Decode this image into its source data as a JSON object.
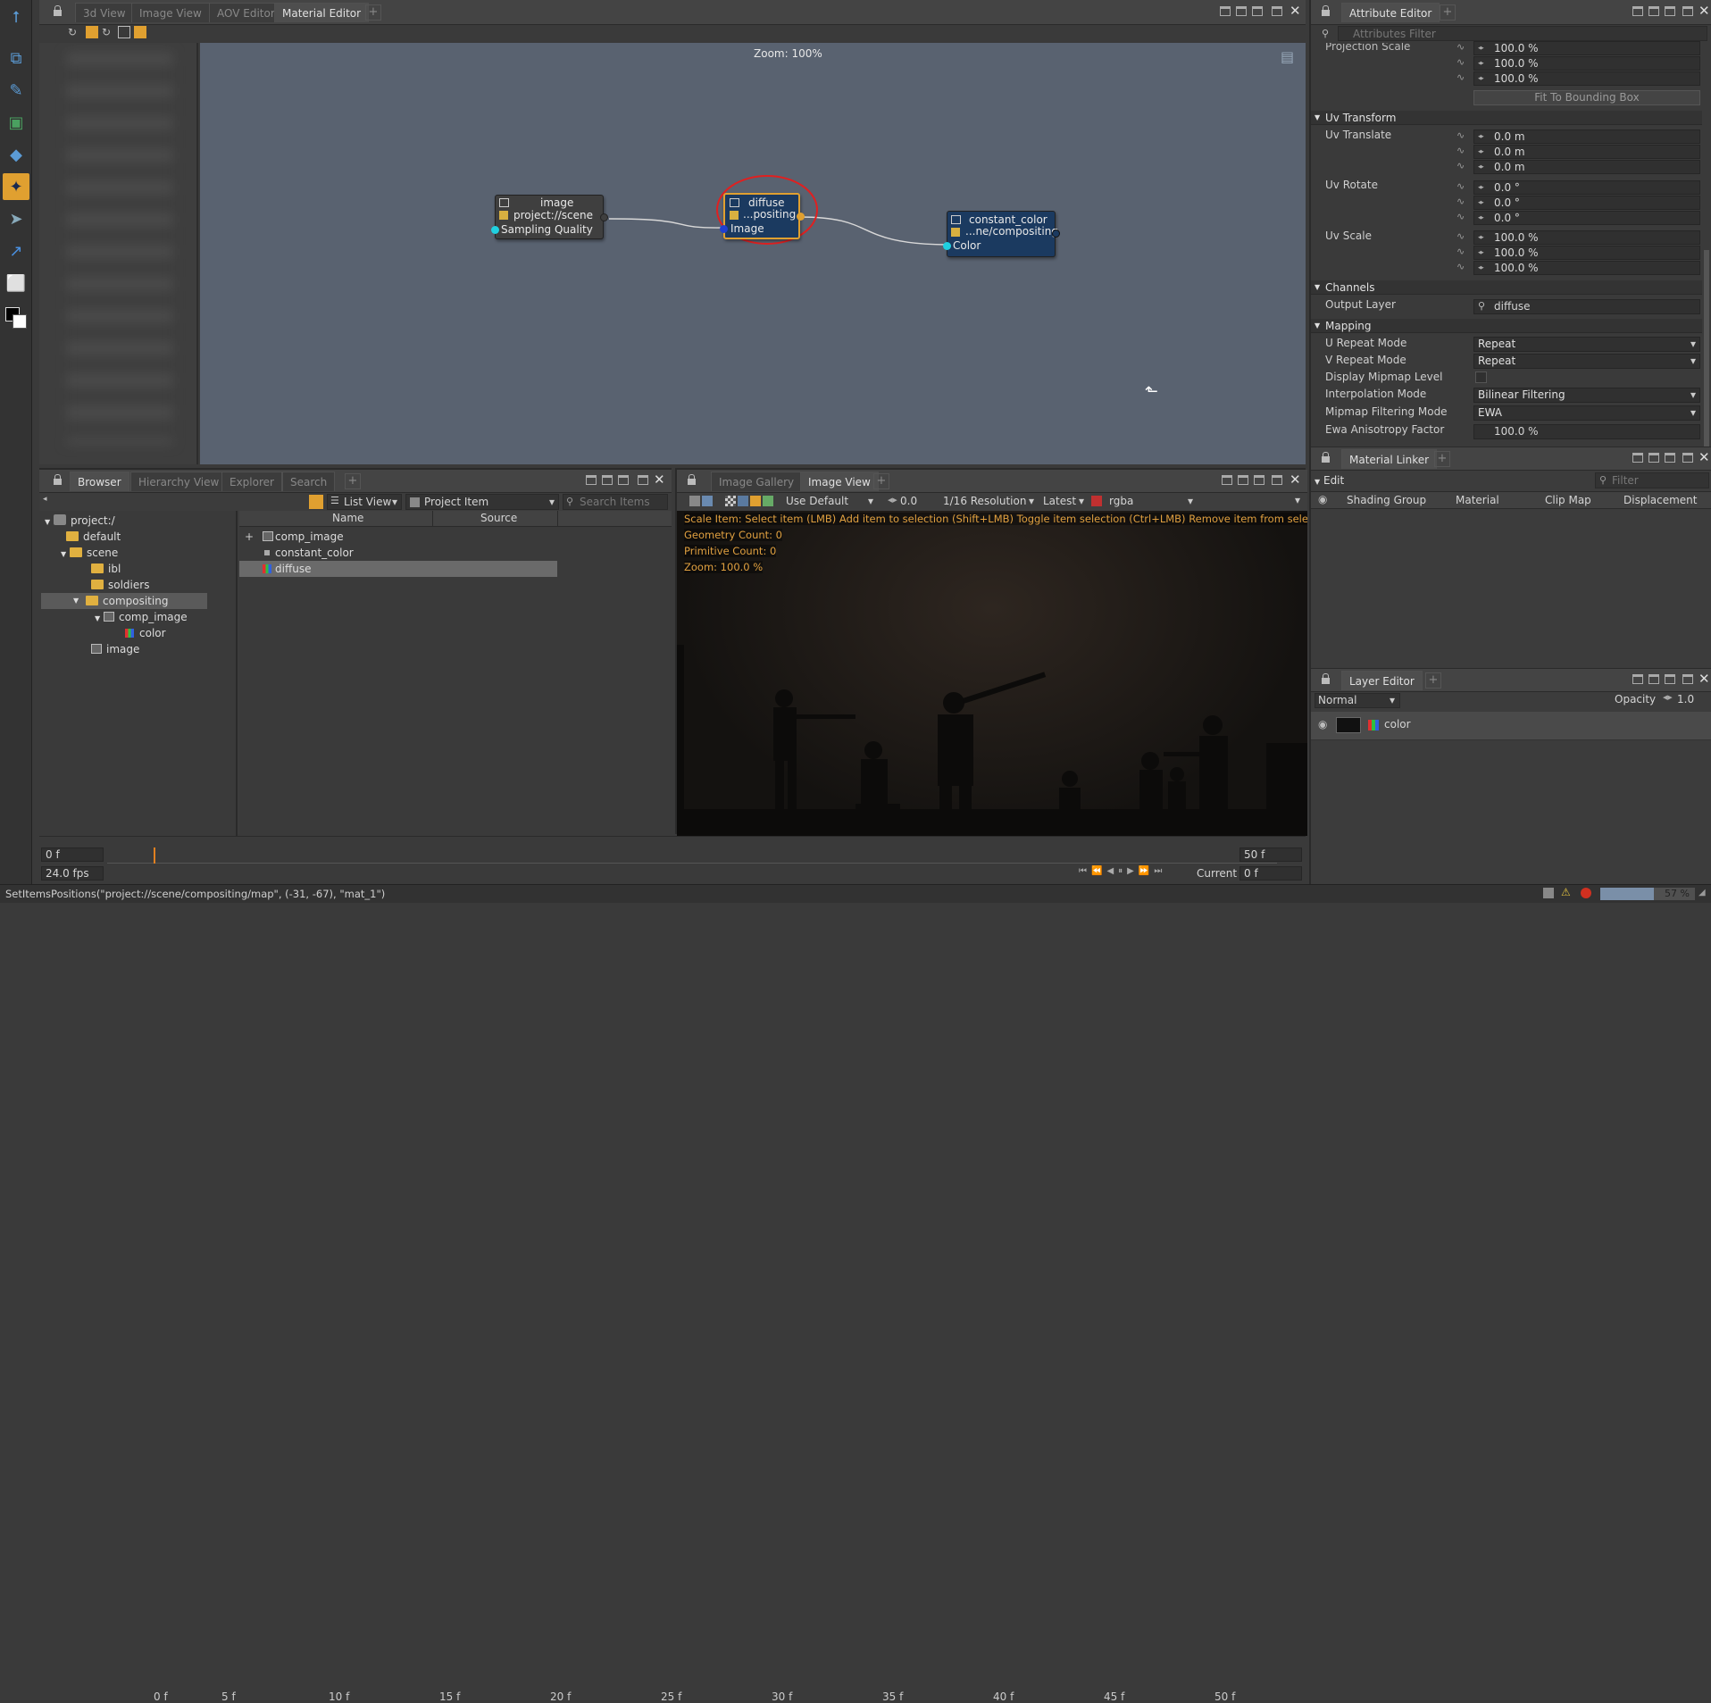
{
  "top_tabs": [
    "3d View",
    "Image View",
    "AOV Editor",
    "Material Editor"
  ],
  "node_editor": {
    "zoom": "Zoom: 100%",
    "nodes": {
      "image": {
        "title": "image",
        "sub": "project://scene",
        "port": "Sampling Quality"
      },
      "diffuse": {
        "title": "diffuse",
        "sub": "...positing",
        "port": "Image"
      },
      "constant": {
        "title": "constant_color",
        "sub": "...ne/compositing",
        "port": "Color"
      }
    }
  },
  "attribute_editor": {
    "tab": "Attribute Editor",
    "filter_placeholder": "Attributes Filter",
    "projection_scale_label": "Projection Scale",
    "projection_scale": [
      "100.0 %",
      "100.0 %",
      "100.0 %"
    ],
    "fit_button": "Fit To Bounding Box",
    "sections": {
      "uv": "Uv Transform",
      "channels": "Channels",
      "mapping": "Mapping"
    },
    "uv_translate_label": "Uv Translate",
    "uv_translate": [
      "0.0 m",
      "0.0 m",
      "0.0 m"
    ],
    "uv_rotate_label": "Uv Rotate",
    "uv_rotate": [
      "0.0 °",
      "0.0 °",
      "0.0 °"
    ],
    "uv_scale_label": "Uv Scale",
    "uv_scale": [
      "100.0 %",
      "100.0 %",
      "100.0 %"
    ],
    "output_layer_label": "Output Layer",
    "output_layer": "diffuse",
    "u_repeat_label": "U Repeat Mode",
    "u_repeat": "Repeat",
    "v_repeat_label": "V Repeat Mode",
    "v_repeat": "Repeat",
    "mipmap_level_label": "Display Mipmap Level",
    "interp_label": "Interpolation Mode",
    "interp": "Bilinear Filtering",
    "mipfilter_label": "Mipmap Filtering Mode",
    "mipfilter": "EWA",
    "ewa_label": "Ewa Anisotropy Factor",
    "ewa": "100.0 %"
  },
  "material_linker": {
    "tab": "Material Linker",
    "edit": "Edit",
    "filter_placeholder": "Filter",
    "columns": [
      "Shading Group",
      "Material",
      "Clip Map",
      "Displacement"
    ]
  },
  "layer_editor": {
    "tab": "Layer Editor",
    "blend": "Normal",
    "opacity_label": "Opacity",
    "opacity": "1.0",
    "layer": "color"
  },
  "browser": {
    "tabs": [
      "Browser",
      "Hierarchy View",
      "Explorer",
      "Search"
    ],
    "view_mode": "List View",
    "item_type": "Project Item",
    "search_placeholder": "Search Items",
    "tree": [
      "project:/",
      "default",
      "scene",
      "ibl",
      "soldiers",
      "compositing",
      "comp_image",
      "color",
      "image"
    ],
    "columns": [
      "Name",
      "Source"
    ],
    "items": [
      "comp_image",
      "constant_color",
      "diffuse"
    ]
  },
  "image_view": {
    "tabs": [
      "Image Gallery",
      "Image View"
    ],
    "use_default": "Use Default",
    "exposure": "0.0",
    "resolution": "1/16 Resolution",
    "latest": "Latest",
    "channel": "rgba",
    "hint": "Scale Item: Select item (LMB)   Add item to selection (Shift+LMB)   Toggle item selection (Ctrl+LMB)   Remove item from sele",
    "stats": [
      "Geometry Count: 0",
      "Primitive Count: 0",
      "Zoom: 100.0 %"
    ]
  },
  "timeline": {
    "start": "0 f",
    "end": "50 f",
    "ticks": [
      "0 f",
      "5 f",
      "10 f",
      "15 f",
      "20 f",
      "25 f",
      "30 f",
      "35 f",
      "40 f",
      "45 f",
      "50 f"
    ],
    "fps": "24.0 fps",
    "current_label": "Current",
    "current": "0 f"
  },
  "status": {
    "command": "SetItemsPositions(\"project://scene/compositing/map\", (-31, -67), \"mat_1\")",
    "progress": "57 %",
    "progress_value": 0.57
  }
}
